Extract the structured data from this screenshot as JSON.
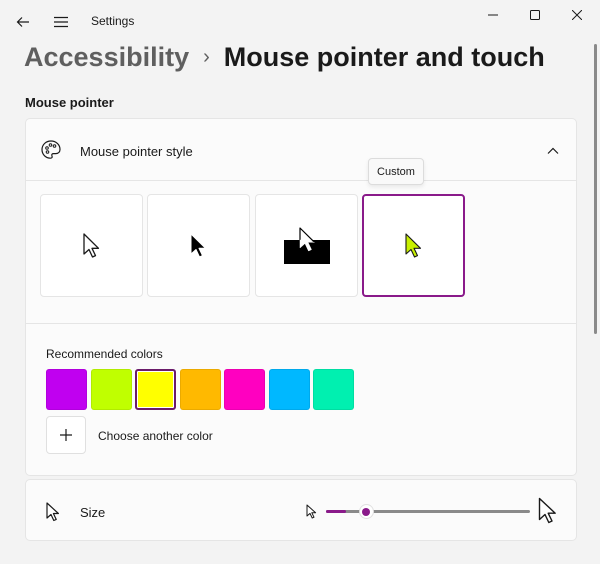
{
  "window": {
    "title": "Settings",
    "icons": {
      "back": "back-arrow-icon",
      "menu": "hamburger-icon",
      "minimize": "minimize-icon",
      "maximize": "maximize-icon",
      "close": "close-icon"
    }
  },
  "breadcrumb": {
    "parent": "Accessibility",
    "separator": "›",
    "current": "Mouse pointer and touch"
  },
  "section": {
    "title": "Mouse pointer"
  },
  "pointer_style": {
    "label": "Mouse pointer style",
    "icon": "palette-icon",
    "expanded": true,
    "tooltip": "Custom",
    "options": [
      {
        "name": "White",
        "selected": false
      },
      {
        "name": "Black",
        "selected": false
      },
      {
        "name": "Inverted",
        "selected": false
      },
      {
        "name": "Custom",
        "selected": true,
        "color": "#c8f000"
      }
    ]
  },
  "colors": {
    "label": "Recommended colors",
    "swatches": [
      "#c000f0",
      "#c0ff00",
      "#ffff00",
      "#ffb900",
      "#ff00c0",
      "#00b8ff",
      "#00f0b0"
    ],
    "selected_index": 2,
    "add_label": "Choose another color",
    "add_icon": "plus-icon"
  },
  "size": {
    "label": "Size",
    "icon": "pointer-icon",
    "value_fraction": 0.1
  },
  "accent_color": "#8a1a8a"
}
